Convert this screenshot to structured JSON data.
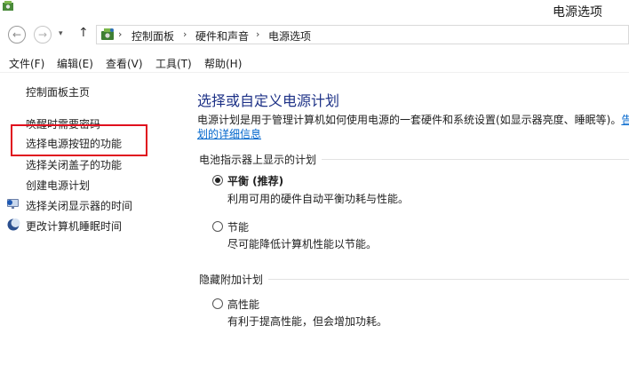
{
  "window": {
    "title": "电源选项"
  },
  "breadcrumb": [
    "控制面板",
    "硬件和声音",
    "电源选项"
  ],
  "nav": {
    "back": "←",
    "forward": "→",
    "recent": "▾",
    "up": "↑",
    "separator": "›"
  },
  "menu": [
    "文件(F)",
    "编辑(E)",
    "查看(V)",
    "工具(T)",
    "帮助(H)"
  ],
  "sidebar": {
    "home": "控制面板主页",
    "items": [
      {
        "label": "唤醒时需要密码",
        "icon": ""
      },
      {
        "label": "选择电源按钮的功能",
        "icon": ""
      },
      {
        "label": "选择关闭盖子的功能",
        "icon": ""
      },
      {
        "label": "创建电源计划",
        "icon": ""
      },
      {
        "label": "选择关闭显示器的时间",
        "icon": "display-power-icon"
      },
      {
        "label": "更改计算机睡眠时间",
        "icon": "sleep-moon-icon"
      }
    ]
  },
  "main": {
    "heading": "选择或自定义电源计划",
    "description": "电源计划是用于管理计算机如何使用电源的一套硬件和系统设置(如显示器亮度、睡眠等)。",
    "description_link_a": "告",
    "description_link_b": "划的详细信息",
    "battery_group_label": "电池指示器上显示的计划",
    "hidden_group_label": "隐藏附加计划",
    "plans": [
      {
        "name": "平衡 (推荐)",
        "description": "利用可用的硬件自动平衡功耗与性能。",
        "selected": true
      },
      {
        "name": "节能",
        "description": "尽可能降低计算机性能以节能。",
        "selected": false
      },
      {
        "name": "高性能",
        "description": "有利于提高性能，但会增加功耗。",
        "selected": false
      }
    ]
  },
  "colors": {
    "heading": "#1e3287",
    "link": "#0066cc",
    "highlight": "#e0101e"
  }
}
